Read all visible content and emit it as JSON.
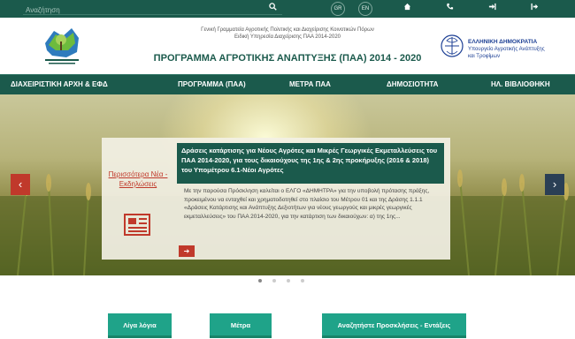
{
  "topbar": {
    "search_placeholder": "Αναζήτηση",
    "lang_gr": "GR",
    "lang_en": "EN",
    "icons": [
      "home-icon",
      "phone-icon",
      "login-icon",
      "logout-icon"
    ]
  },
  "header": {
    "line1": "Γενική Γραμματεία Αγροτικής Πολιτικής και Διαχείρισης Κοινοτικών Πόρων",
    "line2": "Ειδική Υπηρεσία Διαχείρισης ΠΑΑ 2014-2020",
    "title": "ΠΡΟΓΡΑΜΜΑ ΑΓΡΟΤΙΚΗΣ ΑΝΑΠΤΥΞΗΣ (ΠΑΑ) 2014 - 2020",
    "gov_line1": "ΕΛΛΗΝΙΚΗ ΔΗΜΟΚΡΑΤΙΑ",
    "gov_line2": "Υπουργείο Αγροτικής Ανάπτυξης",
    "gov_line3": "και Τροφίμων"
  },
  "nav": [
    "ΔΙΑΧΕΙΡΙΣΤΙΚΗ ΑΡΧΗ & ΕΦΔ",
    "ΠΡΟΓΡΑΜΜΑ (ΠΑΑ)",
    "ΜΕΤΡΑ ΠΑΑ",
    "ΔΗΜΟΣΙΟΤΗΤΑ",
    "ΗΛ. ΒΙΒΛΙΟΘΗΚΗ"
  ],
  "hero": {
    "more_news": "Περισσότερα Νέα - Εκδηλώσεις",
    "card_title": "Δράσεις κατάρτισης για Νέους Αγρότες και Μικρές Γεωργικές Εκμεταλλεύσεις του ΠΑΑ 2014-2020, για τους δικαιούχους της 1ης & 2ης προκήρυξης (2016 & 2018) του Υπομέτρου 6.1-Νέοι Αγρότες",
    "card_body": "Με την παρούσα Πρόσκληση καλείται ο ΕΛΓΟ «ΔΗΜΗΤΡΑ» για την υποβολή πρότασης πράξης, προκειμένου να ενταχθεί και χρηματοδοτηθεί στο πλαίσιο του Μέτρου 01 και της Δράσης 1.1.1 «Δράσεις Κατάρτισης και Ανάπτυξης Δεξιοτήτων για νέους γεωργούς και μικρές γεωργικές εκμεταλλεύσεις» του ΠΑΑ 2014-2020, για την κατάρτιση των δικαιούχων: α) της 1ης...",
    "prev": "‹",
    "next": "›",
    "readmore": "➔"
  },
  "buttons": [
    "Λίγα λόγια",
    "Μέτρα",
    "Αναζητήστε Προσκλήσεις - Εντάξεις"
  ],
  "colors": {
    "brand": "#1b5a4c",
    "accent": "#1fa389",
    "red": "#c0392b"
  }
}
